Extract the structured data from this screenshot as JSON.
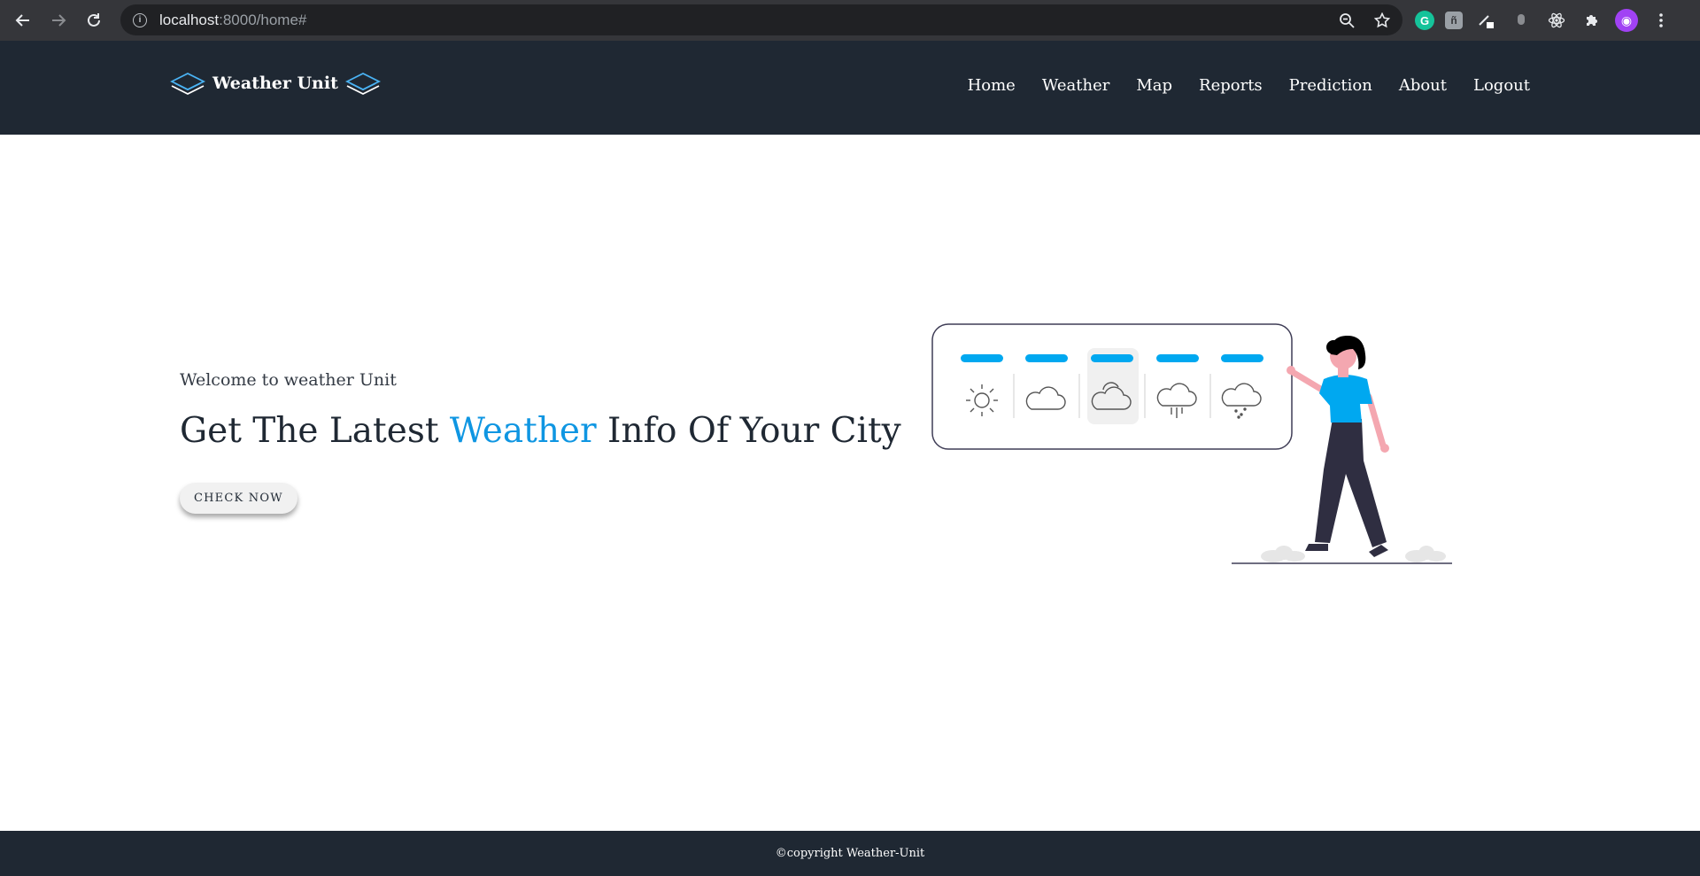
{
  "browser": {
    "url_host": "localhost",
    "url_rest": ":8000/home#"
  },
  "site": {
    "brand": "Weather Unit",
    "nav": [
      "Home",
      "Weather",
      "Map",
      "Reports",
      "Prediction",
      "About",
      "Logout"
    ]
  },
  "hero": {
    "welcome": "Welcome to weather Unit",
    "headline_pre": "Get The Latest ",
    "headline_accent": "Weather",
    "headline_post": " Info Of Your City",
    "cta": "CHECK NOW"
  },
  "illustration": {
    "forecast_icons": [
      "sun-icon",
      "cloud-icon",
      "cloudy-icon",
      "rain-icon",
      "snow-icon"
    ]
  },
  "footer": {
    "copyright": "©copyright Weather-Unit"
  },
  "colors": {
    "header_bg": "#1f2833",
    "accent": "#0f96e2",
    "person_shirt": "#00a8f0"
  }
}
